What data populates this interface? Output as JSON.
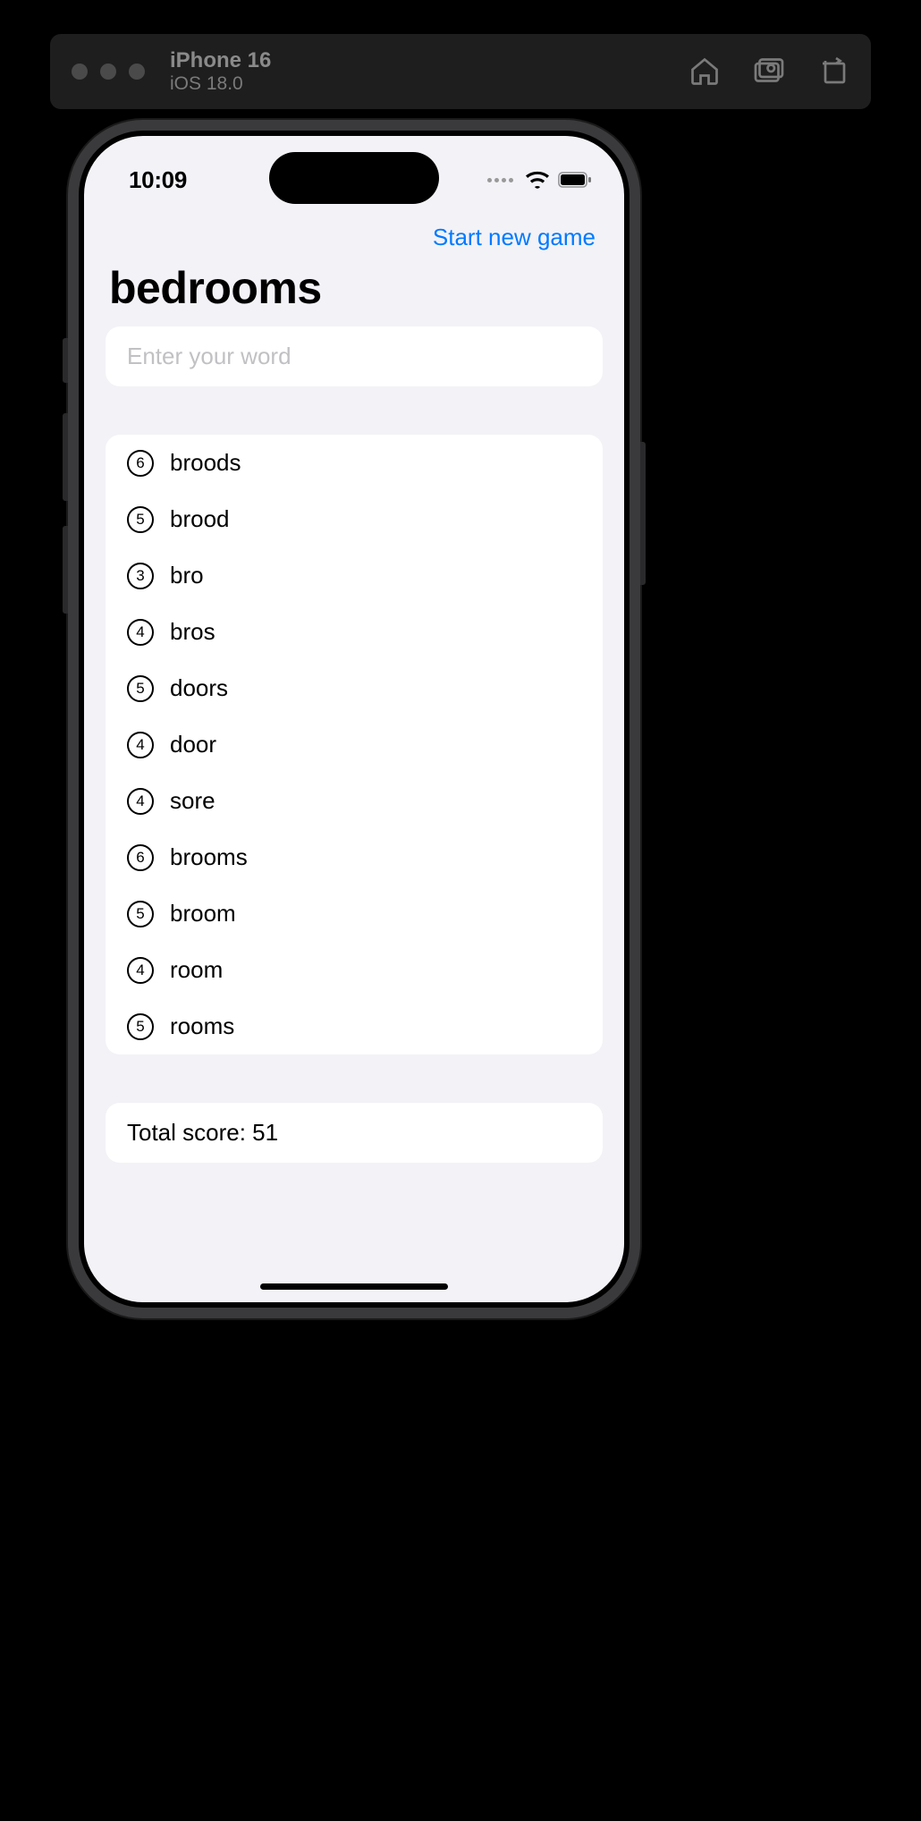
{
  "simulator": {
    "device_name": "iPhone 16",
    "os_version": "iOS 18.0"
  },
  "status_bar": {
    "time": "10:09"
  },
  "nav": {
    "new_game_label": "Start new game"
  },
  "game": {
    "title_word": "bedrooms",
    "input_placeholder": "Enter your word",
    "total_label": "Total score: 51",
    "words": [
      {
        "score": "6",
        "word": "broods"
      },
      {
        "score": "5",
        "word": "brood"
      },
      {
        "score": "3",
        "word": "bro"
      },
      {
        "score": "4",
        "word": "bros"
      },
      {
        "score": "5",
        "word": "doors"
      },
      {
        "score": "4",
        "word": "door"
      },
      {
        "score": "4",
        "word": "sore"
      },
      {
        "score": "6",
        "word": "brooms"
      },
      {
        "score": "5",
        "word": "broom"
      },
      {
        "score": "4",
        "word": "room"
      },
      {
        "score": "5",
        "word": "rooms"
      }
    ]
  }
}
